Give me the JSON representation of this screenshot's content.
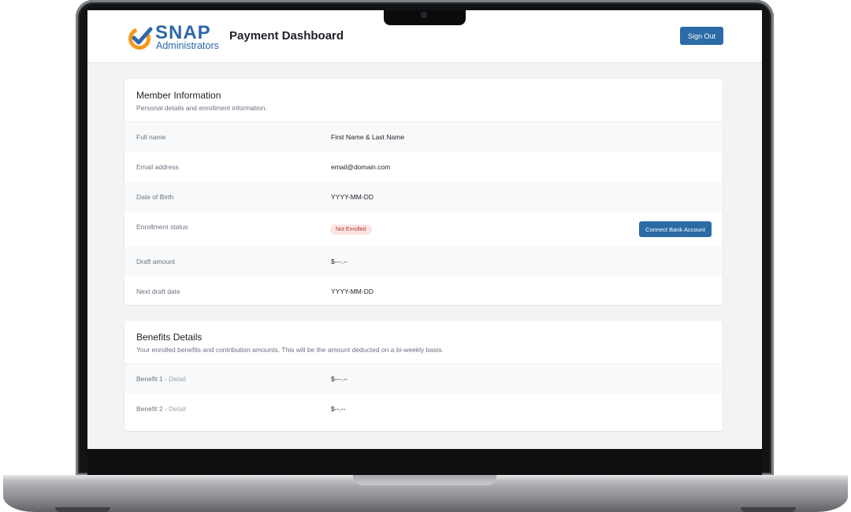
{
  "header": {
    "logo_word": "SNAP",
    "logo_sub": "Administrators",
    "title": "Payment Dashboard",
    "sign_out": "Sign Out"
  },
  "member": {
    "title": "Member Information",
    "subtitle": "Personal details and enrollment information.",
    "rows": [
      {
        "label": "Full name",
        "value": "First Name & Last Name"
      },
      {
        "label": "Email address",
        "value": "email@domain.com"
      },
      {
        "label": "Date of Birth",
        "value": "YYYY-MM-DD"
      },
      {
        "label": "Enrollment status",
        "badge": "Not Enrolled",
        "action": "Connect Bank Account"
      },
      {
        "label": "Draft amount",
        "value": "$---.--"
      },
      {
        "label": "Next draft date",
        "value": "YYYY-MM-DD"
      }
    ]
  },
  "benefits": {
    "title": "Benefits Details",
    "subtitle": "Your enrolled benefits and contribution amounts. This will be the amount deducted on a bi-weekly basis.",
    "rows": [
      {
        "label": "Benefit 1",
        "separator": " - ",
        "detail": "Detail",
        "value": "$---.--"
      },
      {
        "label": "Benefit 2",
        "separator": " - ",
        "detail": "Detail",
        "value": "$--.--"
      }
    ]
  },
  "colors": {
    "accent": "#2b6ba6",
    "logo_orange": "#f29a1f",
    "logo_blue": "#2e67a8",
    "badge_bg": "#fbe4e4",
    "badge_text": "#b33a3a"
  }
}
